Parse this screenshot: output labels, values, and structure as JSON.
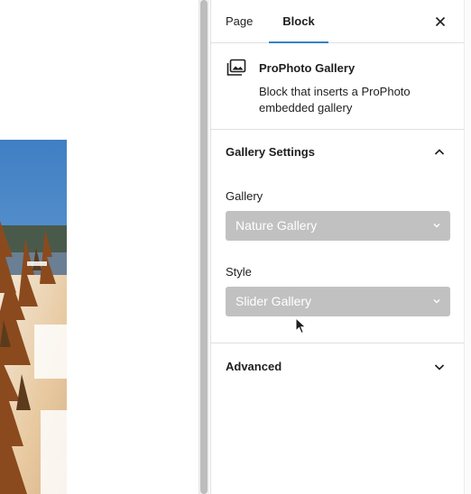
{
  "tabs": {
    "page_label": "Page",
    "block_label": "Block"
  },
  "icons": {
    "close": "close-icon",
    "gallery": "gallery-icon",
    "chevron_up": "chevron-up-icon",
    "chevron_down": "chevron-down-icon"
  },
  "block": {
    "title": "ProPhoto Gallery",
    "description": "Block that inserts a ProPhoto embedded gallery"
  },
  "gallery_settings": {
    "title": "Gallery Settings",
    "gallery_label": "Gallery",
    "gallery_value": "Nature Gallery",
    "style_label": "Style",
    "style_value": "Slider Gallery"
  },
  "advanced": {
    "title": "Advanced"
  },
  "colors": {
    "accent": "#3582c4",
    "select_bg": "#c1c1c2"
  }
}
